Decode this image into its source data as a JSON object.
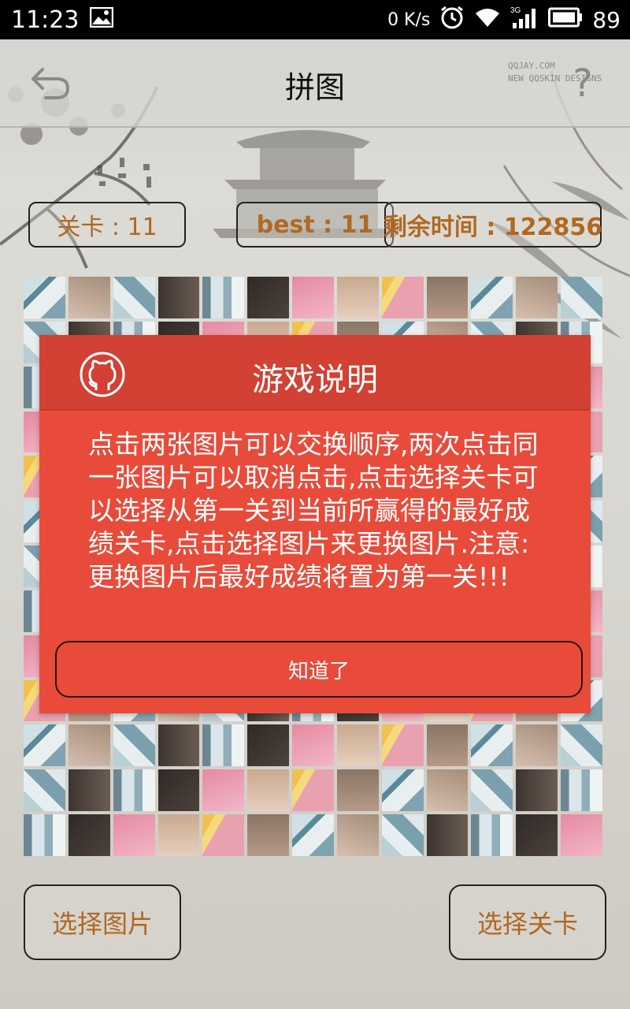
{
  "status_bar": {
    "time": "11:23",
    "net_speed": "0 K/s",
    "battery": "89",
    "icons": [
      "image-icon",
      "alarm-icon",
      "wifi-icon",
      "signal-3g-icon",
      "battery-icon"
    ]
  },
  "header": {
    "title": "拼图",
    "back_icon": "back-arrow-icon",
    "help_icon": "help-icon",
    "help_glyph": "?",
    "watermark_lines": [
      "QQJAY.COM",
      "NEW QQSKIN DESIGNS"
    ]
  },
  "stats": {
    "level_label": "关卡 : 11",
    "best_label": "best : 11",
    "time_label": "剩余时间 : 122856"
  },
  "puzzle": {
    "rows": 13,
    "cols": 13
  },
  "buttons": {
    "pick_image": "选择图片",
    "pick_level": "选择关卡"
  },
  "dialog": {
    "title": "游戏说明",
    "logo_icon": "github-octocat-icon",
    "body": "点击两张图片可以交换顺序,两次点击同一张图片可以取消点击,点击选择关卡可以选择从第一关到当前所赢得的最好成绩关卡,点击选择图片来更换图片.注意:更换图片后最好成绩将置为第一关!!!",
    "ok_label": "知道了"
  },
  "colors": {
    "dialog_bg": "#e84b3a",
    "dialog_header": "#d24133",
    "accent_text": "#b06822"
  }
}
